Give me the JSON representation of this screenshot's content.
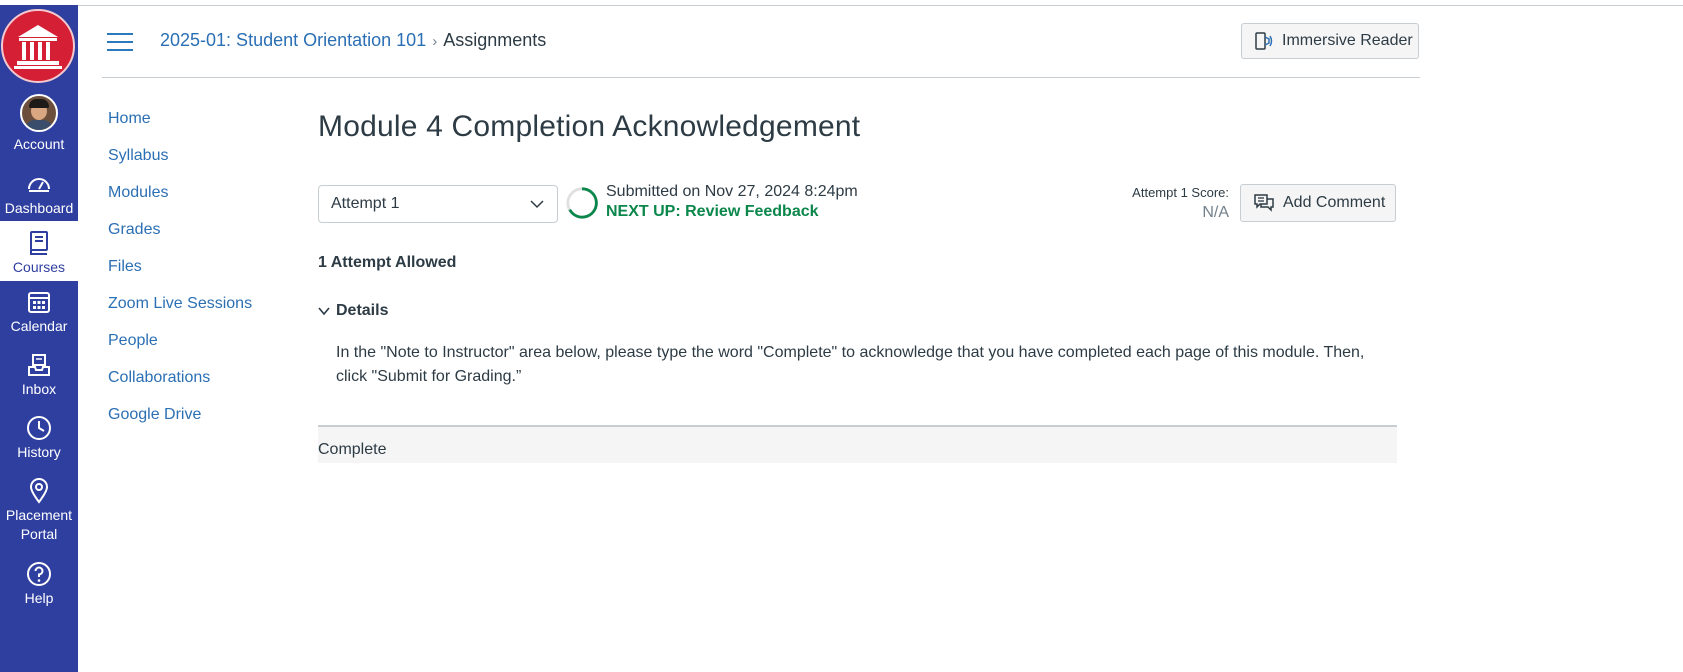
{
  "global_nav": {
    "items": [
      {
        "label": "Account",
        "icon": "avatar"
      },
      {
        "label": "Dashboard",
        "icon": "dashboard-icon"
      },
      {
        "label": "Courses",
        "icon": "courses-icon",
        "active": true
      },
      {
        "label": "Calendar",
        "icon": "calendar-icon"
      },
      {
        "label": "Inbox",
        "icon": "inbox-icon"
      },
      {
        "label": "History",
        "icon": "history-icon"
      },
      {
        "label": "Placement Portal",
        "icon": "location-pin-icon"
      },
      {
        "label": "Help",
        "icon": "help-icon"
      }
    ],
    "colors": {
      "background": "#2f3fa0",
      "logo": "#d51f35"
    }
  },
  "breadcrumb": {
    "course": "2025-01: Student Orientation 101",
    "separator": "›",
    "current": "Assignments"
  },
  "header": {
    "immersive_reader_label": "Immersive Reader"
  },
  "course_nav": {
    "items": [
      "Home",
      "Syllabus",
      "Modules",
      "Grades",
      "Files",
      "Zoom Live Sessions",
      "People",
      "Collaborations",
      "Google Drive"
    ]
  },
  "assignment": {
    "title": "Module 4 Completion Acknowledgement",
    "attempt_select": "Attempt 1",
    "submitted_text": "Submitted on Nov 27, 2024 8:24pm",
    "next_up": "NEXT UP: Review Feedback",
    "score_label": "Attempt 1 Score:",
    "score_value": "N/A",
    "add_comment_label": "Add Comment",
    "attempts_allowed": "1 Attempt Allowed",
    "details_label": "Details",
    "details_text": "In the \"Note to Instructor\" area below, please type the word \"Complete\" to acknowledge that you have completed each page of this module.  Then, click \"Submit for Grading.”",
    "submission_text": "Complete"
  },
  "colors": {
    "link": "#2b6fb4",
    "success": "#0b874b"
  }
}
